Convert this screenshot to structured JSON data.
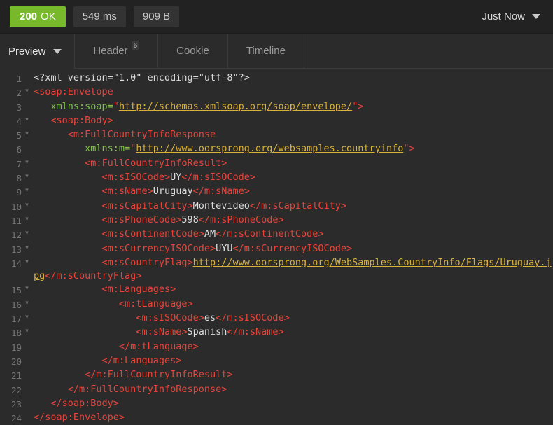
{
  "status_bar": {
    "status_code": "200",
    "status_text": "OK",
    "status_color": "#78b92b",
    "time": "549 ms",
    "size": "909 B",
    "timestamp_label": "Just Now",
    "timestamp_caret_icon": "chevron-down-icon"
  },
  "tab_bar": {
    "preview_label": "Preview",
    "preview_caret_icon": "chevron-down-icon",
    "tabs": [
      {
        "label": "Header",
        "badge": "6",
        "active": false
      },
      {
        "label": "Cookie",
        "badge": "",
        "active": false
      },
      {
        "label": "Timeline",
        "badge": "",
        "active": false
      }
    ]
  },
  "code": {
    "language": "xml",
    "lines": [
      {
        "num": "1",
        "fold": false,
        "indent": 0
      },
      {
        "num": "2",
        "fold": true,
        "indent": 0
      },
      {
        "num": "3",
        "fold": false,
        "indent": 0
      },
      {
        "num": "4",
        "fold": true,
        "indent": 0
      },
      {
        "num": "5",
        "fold": true,
        "indent": 0
      },
      {
        "num": "6",
        "fold": false,
        "indent": 0
      },
      {
        "num": "7",
        "fold": true,
        "indent": 0
      },
      {
        "num": "8",
        "fold": true,
        "indent": 0
      },
      {
        "num": "9",
        "fold": true,
        "indent": 0
      },
      {
        "num": "10",
        "fold": true,
        "indent": 0
      },
      {
        "num": "11",
        "fold": true,
        "indent": 0
      },
      {
        "num": "12",
        "fold": true,
        "indent": 0
      },
      {
        "num": "13",
        "fold": true,
        "indent": 0
      },
      {
        "num": "14",
        "fold": true,
        "indent": 0
      },
      {
        "num": "15",
        "fold": true,
        "indent": 0
      },
      {
        "num": "16",
        "fold": true,
        "indent": 0
      },
      {
        "num": "17",
        "fold": true,
        "indent": 0
      },
      {
        "num": "18",
        "fold": true,
        "indent": 0
      },
      {
        "num": "19",
        "fold": false,
        "indent": 0
      },
      {
        "num": "20",
        "fold": false,
        "indent": 0
      },
      {
        "num": "21",
        "fold": false,
        "indent": 0
      },
      {
        "num": "22",
        "fold": false,
        "indent": 0
      },
      {
        "num": "23",
        "fold": false,
        "indent": 0
      },
      {
        "num": "24",
        "fold": false,
        "indent": 0
      }
    ],
    "text": [
      "<?xml version=\"1.0\" encoding=\"utf-8\"?>",
      "<soap:Envelope",
      "   xmlns:soap=\"http://schemas.xmlsoap.org/soap/envelope/\">",
      "   <soap:Body>",
      "      <m:FullCountryInfoResponse",
      "         xmlns:m=\"http://www.oorsprong.org/websamples.countryinfo\">",
      "         <m:FullCountryInfoResult>",
      "            <m:sISOCode>UY</m:sISOCode>",
      "            <m:sName>Uruguay</m:sName>",
      "            <m:sCapitalCity>Montevideo</m:sCapitalCity>",
      "            <m:sPhoneCode>598</m:sPhoneCode>",
      "            <m:sContinentCode>AM</m:sContinentCode>",
      "            <m:sCurrencyISOCode>UYU</m:sCurrencyISOCode>",
      "            <m:sCountryFlag>http://www.oorsprong.org/WebSamples.CountryInfo/Flags/Uruguay.jpg</m:sCountryFlag>",
      "            <m:Languages>",
      "               <m:tLanguage>",
      "                  <m:sISOCode>es</m:sISOCode>",
      "                  <m:sName>Spanish</m:sName>",
      "               </m:tLanguage>",
      "            </m:Languages>",
      "         </m:FullCountryInfoResult>",
      "      </m:FullCountryInfoResponse>",
      "   </soap:Body>",
      "</soap:Envelope>"
    ],
    "values": {
      "sISOCode": "UY",
      "sName": "Uruguay",
      "sCapitalCity": "Montevideo",
      "sPhoneCode": "598",
      "sContinentCode": "AM",
      "sCurrencyISOCode": "UYU",
      "sCountryFlag": "http://www.oorsprong.org/WebSamples.CountryInfo/Flags/Uruguay.jpg",
      "language_iso": "es",
      "language_name": "Spanish",
      "soap_ns": "http://schemas.xmlsoap.org/soap/envelope/",
      "m_ns": "http://www.oorsprong.org/websamples.countryinfo"
    },
    "colors": {
      "tag": "#e8443a",
      "attribute": "#7ec24a",
      "url": "#d9b13a",
      "text": "#dcdcdc",
      "line_number": "#757575",
      "background": "#2b2b2b"
    }
  }
}
